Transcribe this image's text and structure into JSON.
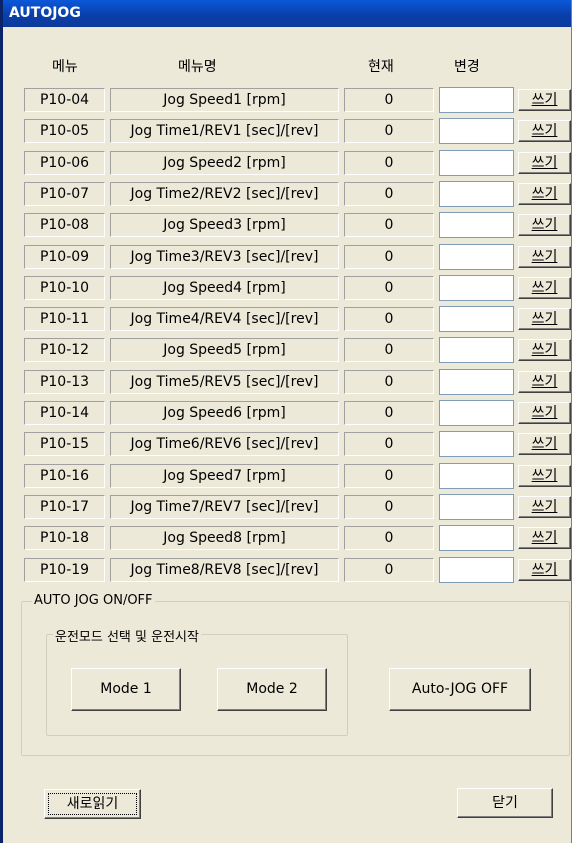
{
  "window": {
    "title": "AUTOJOG"
  },
  "headers": {
    "menu": "메뉴",
    "menu_name": "메뉴명",
    "current": "현재",
    "change": "변경"
  },
  "rows": [
    {
      "code": "P10-04",
      "name": "Jog Speed1 [rpm]",
      "current": "0",
      "change": "",
      "write_label": "쓰기"
    },
    {
      "code": "P10-05",
      "name": "Jog Time1/REV1 [sec]/[rev]",
      "current": "0",
      "change": "",
      "write_label": "쓰기"
    },
    {
      "code": "P10-06",
      "name": "Jog Speed2 [rpm]",
      "current": "0",
      "change": "",
      "write_label": "쓰기"
    },
    {
      "code": "P10-07",
      "name": "Jog Time2/REV2 [sec]/[rev]",
      "current": "0",
      "change": "",
      "write_label": "쓰기"
    },
    {
      "code": "P10-08",
      "name": "Jog Speed3 [rpm]",
      "current": "0",
      "change": "",
      "write_label": "쓰기"
    },
    {
      "code": "P10-09",
      "name": "Jog Time3/REV3 [sec]/[rev]",
      "current": "0",
      "change": "",
      "write_label": "쓰기"
    },
    {
      "code": "P10-10",
      "name": "Jog Speed4 [rpm]",
      "current": "0",
      "change": "",
      "write_label": "쓰기"
    },
    {
      "code": "P10-11",
      "name": "Jog Time4/REV4 [sec]/[rev]",
      "current": "0",
      "change": "",
      "write_label": "쓰기"
    },
    {
      "code": "P10-12",
      "name": "Jog Speed5 [rpm]",
      "current": "0",
      "change": "",
      "write_label": "쓰기"
    },
    {
      "code": "P10-13",
      "name": "Jog Time5/REV5 [sec]/[rev]",
      "current": "0",
      "change": "",
      "write_label": "쓰기"
    },
    {
      "code": "P10-14",
      "name": "Jog Speed6 [rpm]",
      "current": "0",
      "change": "",
      "write_label": "쓰기"
    },
    {
      "code": "P10-15",
      "name": "Jog Time6/REV6 [sec]/[rev]",
      "current": "0",
      "change": "",
      "write_label": "쓰기"
    },
    {
      "code": "P10-16",
      "name": "Jog Speed7 [rpm]",
      "current": "0",
      "change": "",
      "write_label": "쓰기"
    },
    {
      "code": "P10-17",
      "name": "Jog Time7/REV7 [sec]/[rev]",
      "current": "0",
      "change": "",
      "write_label": "쓰기"
    },
    {
      "code": "P10-18",
      "name": "Jog Speed8 [rpm]",
      "current": "0",
      "change": "",
      "write_label": "쓰기"
    },
    {
      "code": "P10-19",
      "name": "Jog Time8/REV8 [sec]/[rev]",
      "current": "0",
      "change": "",
      "write_label": "쓰기"
    }
  ],
  "autojog_group": {
    "label": "AUTO JOG ON/OFF",
    "mode_group_label": "운전모드 선택 및 운전시작",
    "mode1_label": "Mode 1",
    "mode2_label": "Mode 2",
    "off_label": "Auto-JOG OFF"
  },
  "footer": {
    "refresh_label": "새로읽기",
    "close_label": "닫기"
  },
  "colors": {
    "titlebar": "#0a3ea8",
    "face": "#ece9d8"
  }
}
